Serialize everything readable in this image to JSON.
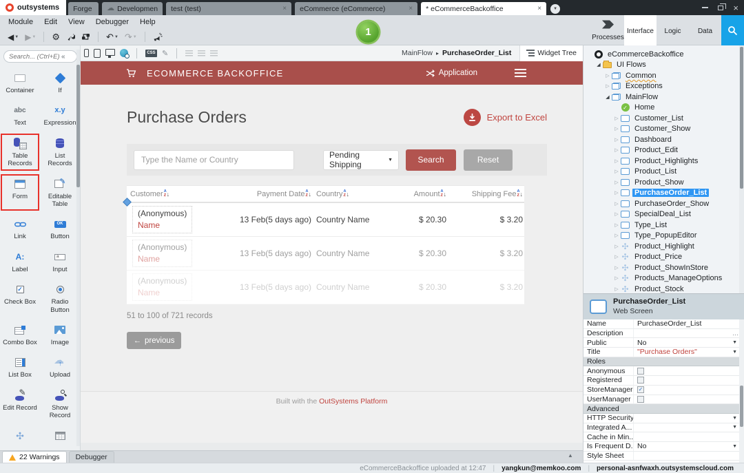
{
  "colors": {
    "brand_red": "#a94f4b",
    "link_red": "#c0443f",
    "selection_blue": "#2f96f3",
    "os_blue": "#17a3e8",
    "publish_green": "#55a32d",
    "warning_orange": "#f6a623"
  },
  "titlebar": {
    "logo_text": "outsystems",
    "tabs": [
      {
        "label": "Forge",
        "closable": false,
        "active": false,
        "cloud": false
      },
      {
        "label": "Development...",
        "closable": false,
        "active": false,
        "cloud": true
      },
      {
        "label": "test (test)",
        "closable": true,
        "active": false,
        "cloud": false
      },
      {
        "label": "eCommerce (eCommerce)",
        "closable": true,
        "active": false,
        "cloud": false
      },
      {
        "label": "* eCommerceBackoffice",
        "closable": true,
        "active": true,
        "cloud": false
      }
    ]
  },
  "menubar": {
    "items": [
      "Module",
      "Edit",
      "View",
      "Debugger",
      "Help"
    ]
  },
  "toolbar": {
    "publish_step_badge": "1"
  },
  "nav": {
    "tabs": [
      {
        "label": "Processes",
        "icon": "processes-icon",
        "active": false
      },
      {
        "label": "Interface",
        "icon": "interface-icon",
        "active": true
      },
      {
        "label": "Logic",
        "icon": "logic-icon",
        "active": false
      },
      {
        "label": "Data",
        "icon": "data-icon",
        "active": false
      }
    ]
  },
  "toolbox": {
    "search_placeholder": "Search... (Ctrl+E)",
    "collapse_glyph": "«",
    "widgets": [
      {
        "label": "Container",
        "icon": "container"
      },
      {
        "label": "If",
        "icon": "if"
      },
      {
        "label": "Text",
        "icon": "text",
        "glyph": "abc"
      },
      {
        "label": "Expression",
        "icon": "expression",
        "glyph": "x.y"
      },
      {
        "label": "Table Records",
        "icon": "table-records",
        "highlighted": true
      },
      {
        "label": "List Records",
        "icon": "list-records"
      },
      {
        "label": "Form",
        "icon": "form",
        "highlighted": true
      },
      {
        "label": "Editable Table",
        "icon": "editable-table"
      },
      {
        "label": "Link",
        "icon": "link"
      },
      {
        "label": "Button",
        "icon": "button",
        "glyph": "OK"
      },
      {
        "label": "Label",
        "icon": "label",
        "glyph": "A:"
      },
      {
        "label": "Input",
        "icon": "input",
        "glyph": "a"
      },
      {
        "label": "Check Box",
        "icon": "checkbox"
      },
      {
        "label": "Radio Button",
        "icon": "radio"
      },
      {
        "label": "Combo Box",
        "icon": "combobox"
      },
      {
        "label": "Image",
        "icon": "image"
      },
      {
        "label": "List Box",
        "icon": "listbox"
      },
      {
        "label": "Upload",
        "icon": "upload"
      },
      {
        "label": "Edit Record",
        "icon": "edit-record"
      },
      {
        "label": "Show Record",
        "icon": "show-record"
      },
      {
        "label": "",
        "icon": "extension"
      },
      {
        "label": "",
        "icon": "grid"
      }
    ]
  },
  "canvas": {
    "breadcrumb": {
      "flow": "MainFlow",
      "separator": "▸",
      "screen": "PurchaseOrder_List"
    },
    "widget_tree_label": "Widget Tree",
    "css_badge": "CSS"
  },
  "page": {
    "header": {
      "title": "ECOMMERCE BACKOFFICE",
      "menu_label": "Application"
    },
    "title": "Purchase Orders",
    "export_label": "Export to Excel",
    "filter": {
      "search_placeholder": "Type the Name or Country",
      "status_value": "Pending Shipping",
      "search_label": "Search",
      "reset_label": "Reset"
    },
    "table": {
      "columns": [
        {
          "label": "Customer",
          "align": "left"
        },
        {
          "label": "Payment Date",
          "align": "right"
        },
        {
          "label": "Country",
          "align": "left"
        },
        {
          "label": "Amount",
          "align": "right"
        },
        {
          "label": "Shipping Fee",
          "align": "right"
        }
      ],
      "rows": [
        {
          "customer": "(Anonymous)",
          "customer_link": "Name",
          "payment_date": "13 Feb(5 days ago)",
          "country": "Country Name",
          "amount": "$ 20.30",
          "shipping_fee": "$ 3.20"
        },
        {
          "customer": "(Anonymous)",
          "customer_link": "Name",
          "payment_date": "13 Feb(5 days ago)",
          "country": "Country Name",
          "amount": "$ 20.30",
          "shipping_fee": "$ 3.20"
        },
        {
          "customer": "(Anonymous)",
          "customer_link": "Name",
          "payment_date": "13 Feb(5 days ago)",
          "country": "Country Name",
          "amount": "$ 20.30",
          "shipping_fee": "$ 3.20"
        }
      ]
    },
    "records_info": "51 to 100 of 721 records",
    "pagination_prev": "previous",
    "footer": {
      "text": "Built with the",
      "link": "OutSystems Platform"
    }
  },
  "tree": {
    "items": [
      {
        "label": "eCommerceBackoffice",
        "icon": "module",
        "depth": 0,
        "expander": "none"
      },
      {
        "label": "UI Flows",
        "icon": "folder",
        "depth": 1,
        "expander": "expanded"
      },
      {
        "label": "Common",
        "icon": "flow",
        "depth": 2,
        "expander": "collapsed",
        "squiggle": true
      },
      {
        "label": "Exceptions",
        "icon": "flow",
        "depth": 2,
        "expander": "collapsed"
      },
      {
        "label": "MainFlow",
        "icon": "flow",
        "depth": 2,
        "expander": "expanded"
      },
      {
        "label": "Home",
        "icon": "home",
        "depth": 3,
        "expander": "none"
      },
      {
        "label": "Customer_List",
        "icon": "screen",
        "depth": 3,
        "expander": "collapsed"
      },
      {
        "label": "Customer_Show",
        "icon": "screen",
        "depth": 3,
        "expander": "collapsed"
      },
      {
        "label": "Dashboard",
        "icon": "screen",
        "depth": 3,
        "expander": "collapsed"
      },
      {
        "label": "Product_Edit",
        "icon": "screen",
        "depth": 3,
        "expander": "collapsed"
      },
      {
        "label": "Product_Highlights",
        "icon": "screen",
        "depth": 3,
        "expander": "collapsed"
      },
      {
        "label": "Product_List",
        "icon": "screen",
        "depth": 3,
        "expander": "collapsed"
      },
      {
        "label": "Product_Show",
        "icon": "screen",
        "depth": 3,
        "expander": "collapsed"
      },
      {
        "label": "PurchaseOrder_List",
        "icon": "screen",
        "depth": 3,
        "expander": "collapsed",
        "selected": true
      },
      {
        "label": "PurchaseOrder_Show",
        "icon": "screen",
        "depth": 3,
        "expander": "collapsed"
      },
      {
        "label": "SpecialDeal_List",
        "icon": "screen",
        "depth": 3,
        "expander": "collapsed"
      },
      {
        "label": "Type_List",
        "icon": "screen",
        "depth": 3,
        "expander": "collapsed"
      },
      {
        "label": "Type_PopupEditor",
        "icon": "screen",
        "depth": 3,
        "expander": "collapsed"
      },
      {
        "label": "Product_Highlight",
        "icon": "webblock",
        "depth": 3,
        "expander": "collapsed"
      },
      {
        "label": "Product_Price",
        "icon": "webblock",
        "depth": 3,
        "expander": "collapsed"
      },
      {
        "label": "Product_ShowInStore",
        "icon": "webblock",
        "depth": 3,
        "expander": "collapsed"
      },
      {
        "label": "Products_ManageOptions",
        "icon": "webblock",
        "depth": 3,
        "expander": "collapsed"
      },
      {
        "label": "Product_Stock",
        "icon": "webblock",
        "depth": 3,
        "expander": "collapsed"
      }
    ]
  },
  "properties": {
    "title": "PurchaseOrder_List",
    "subtitle": "Web Screen",
    "rows": [
      {
        "label": "Name",
        "type": "text",
        "value": "PurchaseOrder_List"
      },
      {
        "label": "Description",
        "type": "ellipsis",
        "value": "..."
      },
      {
        "label": "Public",
        "type": "dropdown",
        "value": "No"
      },
      {
        "label": "Title",
        "type": "dropdown",
        "value": "\"Purchase Orders\"",
        "value_color": "red"
      },
      {
        "label": "Roles",
        "type": "section"
      },
      {
        "label": "Anonymous",
        "type": "checkbox",
        "checked": false
      },
      {
        "label": "Registered",
        "type": "checkbox",
        "checked": false
      },
      {
        "label": "StoreManager",
        "type": "checkbox",
        "checked": true
      },
      {
        "label": "UserManager",
        "type": "checkbox",
        "checked": false
      },
      {
        "label": "Advanced",
        "type": "section"
      },
      {
        "label": "HTTP Security",
        "type": "dropdown",
        "value": ""
      },
      {
        "label": "Integrated A...",
        "type": "dropdown",
        "value": ""
      },
      {
        "label": "Cache in Min...",
        "type": "text",
        "value": ""
      },
      {
        "label": "Is Frequent D...",
        "type": "dropdown",
        "value": "No"
      },
      {
        "label": "Style Sheet",
        "type": "text",
        "value": ""
      }
    ]
  },
  "warnbar": {
    "warnings_label": "22 Warnings",
    "debugger_label": "Debugger"
  },
  "statusbar": {
    "upload_info": "eCommerceBackoffice uploaded at 12:47",
    "separator": "|",
    "user": "yangkun@memkoo.com",
    "host": "personal-asnfwaxh.outsystemscloud.com"
  }
}
